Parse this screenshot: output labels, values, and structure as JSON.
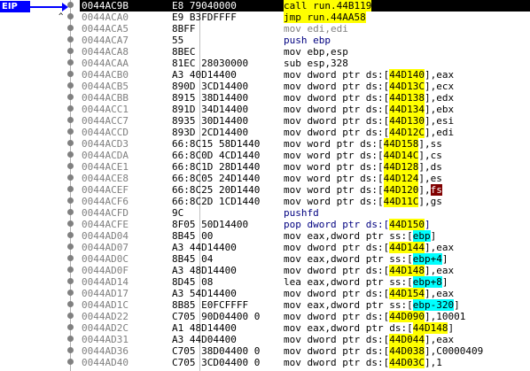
{
  "eip_label": "EIP",
  "rows": [
    {
      "addr": "0044AC9B",
      "bytes": "E8 79040000",
      "parts": [
        {
          "t": "call ",
          "cls": "hl-call"
        },
        {
          "t": "run.44B119",
          "cls": "hl-call"
        }
      ],
      "current": true,
      "mark": ""
    },
    {
      "addr": "0044ACA0",
      "bytes": "E9 B3FDFFFF",
      "parts": [
        {
          "t": "jmp ",
          "cls": "hl-jmp"
        },
        {
          "t": "run.44AA58",
          "cls": "hl-jmp"
        }
      ],
      "mark": "^"
    },
    {
      "addr": "0044ACA5",
      "bytes": "8BFF",
      "parts": [
        {
          "t": "mov edi,edi",
          "cls": "mn-gray"
        }
      ]
    },
    {
      "addr": "0044ACA7",
      "bytes": "55",
      "parts": [
        {
          "t": "push ebp",
          "cls": "mn-blue"
        }
      ]
    },
    {
      "addr": "0044ACA8",
      "bytes": "8BEC",
      "parts": [
        {
          "t": "mov ebp,esp"
        }
      ]
    },
    {
      "addr": "0044ACAA",
      "bytes": "81EC 28030000",
      "parts": [
        {
          "t": "sub esp,328"
        }
      ]
    },
    {
      "addr": "0044ACB0",
      "bytes": "A3 40D14400",
      "parts": [
        {
          "t": "mov dword ptr ds:["
        },
        {
          "t": "44D140",
          "cls": "addr-box"
        },
        {
          "t": "],eax"
        }
      ]
    },
    {
      "addr": "0044ACB5",
      "bytes": "890D 3CD14400",
      "parts": [
        {
          "t": "mov dword ptr ds:["
        },
        {
          "t": "44D13C",
          "cls": "addr-box"
        },
        {
          "t": "],ecx"
        }
      ]
    },
    {
      "addr": "0044ACBB",
      "bytes": "8915 38D14400",
      "parts": [
        {
          "t": "mov dword ptr ds:["
        },
        {
          "t": "44D138",
          "cls": "addr-box"
        },
        {
          "t": "],edx"
        }
      ]
    },
    {
      "addr": "0044ACC1",
      "bytes": "891D 34D14400",
      "parts": [
        {
          "t": "mov dword ptr ds:["
        },
        {
          "t": "44D134",
          "cls": "addr-box"
        },
        {
          "t": "],ebx"
        }
      ]
    },
    {
      "addr": "0044ACC7",
      "bytes": "8935 30D14400",
      "parts": [
        {
          "t": "mov dword ptr ds:["
        },
        {
          "t": "44D130",
          "cls": "addr-box"
        },
        {
          "t": "],esi"
        }
      ]
    },
    {
      "addr": "0044ACCD",
      "bytes": "893D 2CD14400",
      "parts": [
        {
          "t": "mov dword ptr ds:["
        },
        {
          "t": "44D12C",
          "cls": "addr-box"
        },
        {
          "t": "],edi"
        }
      ]
    },
    {
      "addr": "0044ACD3",
      "bytes": "66:8C15 58D1440",
      "parts": [
        {
          "t": "mov word ptr ds:["
        },
        {
          "t": "44D158",
          "cls": "addr-box"
        },
        {
          "t": "],ss"
        }
      ]
    },
    {
      "addr": "0044ACDA",
      "bytes": "66:8C0D 4CD1440",
      "parts": [
        {
          "t": "mov word ptr ds:["
        },
        {
          "t": "44D14C",
          "cls": "addr-box"
        },
        {
          "t": "],cs"
        }
      ]
    },
    {
      "addr": "0044ACE1",
      "bytes": "66:8C1D 28D1440",
      "parts": [
        {
          "t": "mov word ptr ds:["
        },
        {
          "t": "44D128",
          "cls": "addr-box"
        },
        {
          "t": "],ds"
        }
      ]
    },
    {
      "addr": "0044ACE8",
      "bytes": "66:8C05 24D1440",
      "parts": [
        {
          "t": "mov word ptr ds:["
        },
        {
          "t": "44D124",
          "cls": "addr-box"
        },
        {
          "t": "],es"
        }
      ]
    },
    {
      "addr": "0044ACEF",
      "bytes": "66:8C25 20D1440",
      "parts": [
        {
          "t": "mov word ptr ds:["
        },
        {
          "t": "44D120",
          "cls": "addr-box"
        },
        {
          "t": "],"
        },
        {
          "t": "fs",
          "cls": "fs-box"
        }
      ]
    },
    {
      "addr": "0044ACF6",
      "bytes": "66:8C2D 1CD1440",
      "parts": [
        {
          "t": "mov word ptr ds:["
        },
        {
          "t": "44D11C",
          "cls": "addr-box"
        },
        {
          "t": "],gs"
        }
      ]
    },
    {
      "addr": "0044ACFD",
      "bytes": "9C",
      "parts": [
        {
          "t": "pushfd",
          "cls": "mn-blue"
        }
      ]
    },
    {
      "addr": "0044ACFE",
      "bytes": "8F05 50D14400",
      "parts": [
        {
          "t": "pop dword ptr ds:[",
          "cls": "mn-blue"
        },
        {
          "t": "44D150",
          "cls": "addr-box"
        },
        {
          "t": "]",
          "cls": "mn-blue"
        }
      ]
    },
    {
      "addr": "0044AD04",
      "bytes": "8B45 00",
      "parts": [
        {
          "t": "mov eax,dword ptr ss:["
        },
        {
          "t": "ebp",
          "cls": "seg-box"
        },
        {
          "t": "]"
        }
      ]
    },
    {
      "addr": "0044AD07",
      "bytes": "A3 44D14400",
      "parts": [
        {
          "t": "mov dword ptr ds:["
        },
        {
          "t": "44D144",
          "cls": "addr-box"
        },
        {
          "t": "],eax"
        }
      ]
    },
    {
      "addr": "0044AD0C",
      "bytes": "8B45 04",
      "parts": [
        {
          "t": "mov eax,dword ptr ss:["
        },
        {
          "t": "ebp+4",
          "cls": "seg-box"
        },
        {
          "t": "]"
        }
      ]
    },
    {
      "addr": "0044AD0F",
      "bytes": "A3 48D14400",
      "parts": [
        {
          "t": "mov dword ptr ds:["
        },
        {
          "t": "44D148",
          "cls": "addr-box"
        },
        {
          "t": "],eax"
        }
      ]
    },
    {
      "addr": "0044AD14",
      "bytes": "8D45 08",
      "parts": [
        {
          "t": "lea eax,dword ptr ss:["
        },
        {
          "t": "ebp+8",
          "cls": "seg-box"
        },
        {
          "t": "]"
        }
      ]
    },
    {
      "addr": "0044AD17",
      "bytes": "A3 54D14400",
      "parts": [
        {
          "t": "mov dword ptr ds:["
        },
        {
          "t": "44D154",
          "cls": "addr-box"
        },
        {
          "t": "],eax"
        }
      ]
    },
    {
      "addr": "0044AD1C",
      "bytes": "8B85 E0FCFFFF",
      "parts": [
        {
          "t": "mov eax,dword ptr ss:["
        },
        {
          "t": "ebp-320",
          "cls": "seg-box"
        },
        {
          "t": "]"
        }
      ]
    },
    {
      "addr": "0044AD22",
      "bytes": "C705 90D04400 0",
      "parts": [
        {
          "t": "mov dword ptr ds:["
        },
        {
          "t": "44D090",
          "cls": "addr-box"
        },
        {
          "t": "],10001"
        }
      ]
    },
    {
      "addr": "0044AD2C",
      "bytes": "A1 48D14400",
      "parts": [
        {
          "t": "mov eax,dword ptr ds:["
        },
        {
          "t": "44D148",
          "cls": "addr-box"
        },
        {
          "t": "]"
        }
      ]
    },
    {
      "addr": "0044AD31",
      "bytes": "A3 44D04400",
      "parts": [
        {
          "t": "mov dword ptr ds:["
        },
        {
          "t": "44D044",
          "cls": "addr-box"
        },
        {
          "t": "],eax"
        }
      ]
    },
    {
      "addr": "0044AD36",
      "bytes": "C705 38D04400 0",
      "parts": [
        {
          "t": "mov dword ptr ds:["
        },
        {
          "t": "44D038",
          "cls": "addr-box"
        },
        {
          "t": "],C0000409"
        }
      ]
    },
    {
      "addr": "0044AD40",
      "bytes": "C705 3CD04400 0",
      "parts": [
        {
          "t": "mov dword ptr ds:["
        },
        {
          "t": "44D03C",
          "cls": "addr-box"
        },
        {
          "t": "],1"
        }
      ]
    }
  ]
}
